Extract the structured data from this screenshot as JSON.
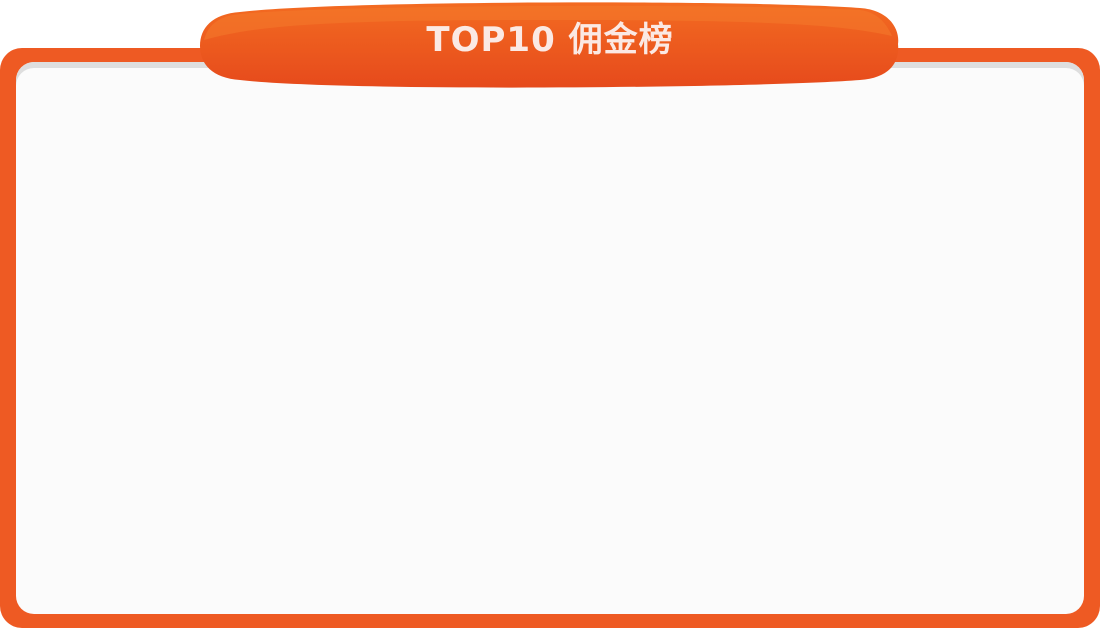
{
  "banner": {
    "title": "TOP10 佣金榜"
  },
  "colors": {
    "frame": "#ee5a23",
    "banner_top": "#f36b21",
    "banner_bottom": "#e64a1c",
    "panel": "#fbfbfb",
    "title_text": "#fbe9e4"
  }
}
